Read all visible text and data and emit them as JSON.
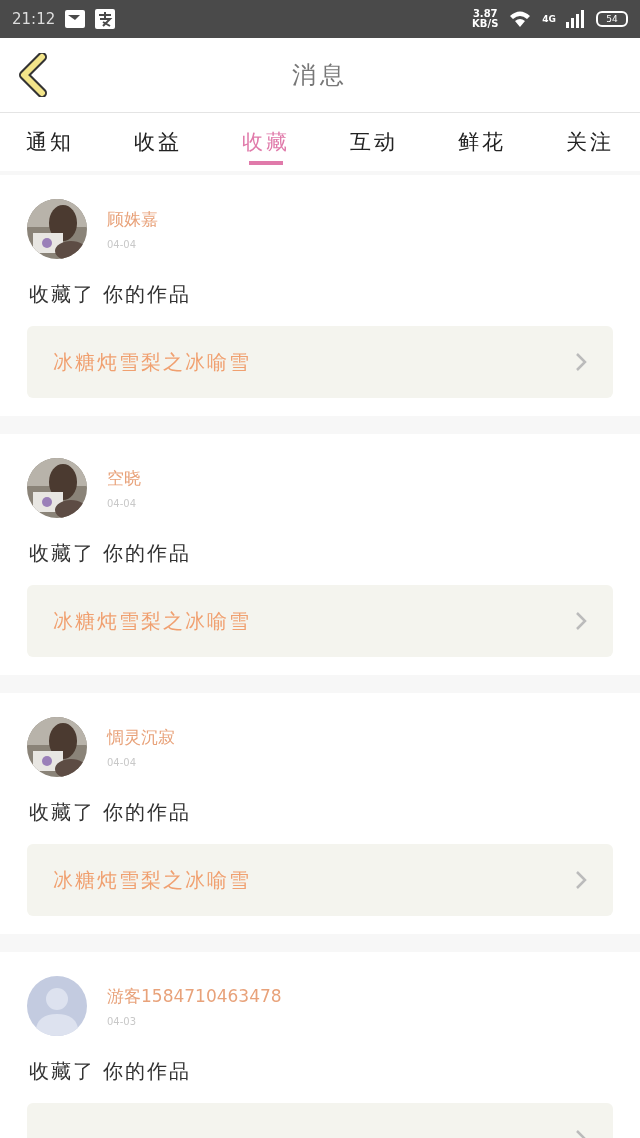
{
  "status_bar": {
    "time": "21:12",
    "speed_value": "3.87",
    "speed_unit": "KB/S",
    "network": "4G",
    "battery": "54"
  },
  "header": {
    "title": "消息"
  },
  "tabs": [
    {
      "label": "通知",
      "selected": false
    },
    {
      "label": "收益",
      "selected": false
    },
    {
      "label": "收藏",
      "selected": true
    },
    {
      "label": "互动",
      "selected": false
    },
    {
      "label": "鲜花",
      "selected": false
    },
    {
      "label": "关注",
      "selected": false
    }
  ],
  "messages": [
    {
      "name": "顾姝嘉",
      "date": "04-04",
      "action": "收藏了 你的作品",
      "work": "冰糖炖雪梨之冰喻雪"
    },
    {
      "name": "空晓",
      "date": "04-04",
      "action": "收藏了 你的作品",
      "work": "冰糖炖雪梨之冰喻雪"
    },
    {
      "name": "惆灵沉寂",
      "date": "04-04",
      "action": "收藏了 你的作品",
      "work": "冰糖炖雪梨之冰喻雪"
    },
    {
      "avatar": {
        "kind": "default"
      },
      "name": "游客1584710463478",
      "date": "04-03",
      "action": "收藏了 你的作品"
    }
  ]
}
